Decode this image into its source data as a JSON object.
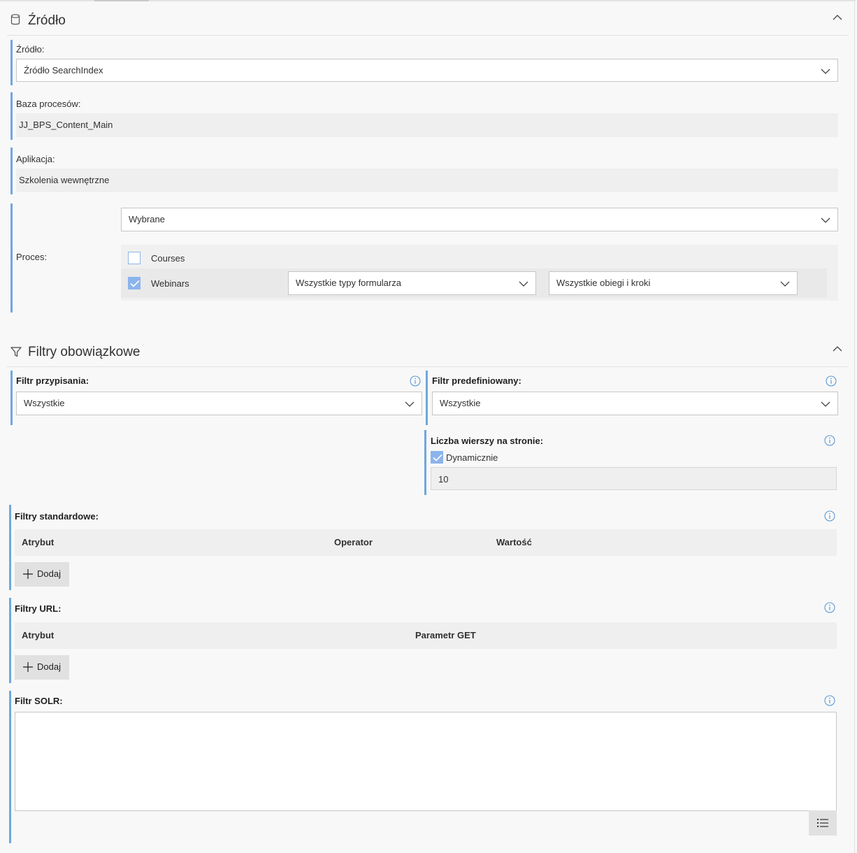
{
  "source_section": {
    "title": "Źródło",
    "source_label": "Źródło:",
    "source_value": "Źródło SearchIndex",
    "process_db_label": "Baza procesów:",
    "process_db_value": "JJ_BPS_Content_Main",
    "app_label": "Aplikacja:",
    "app_value": "Szkolenia wewnętrzne",
    "process_label": "Proces:",
    "process_mode": "Wybrane",
    "processes": [
      {
        "name": "Courses",
        "checked": false
      },
      {
        "name": "Webinars",
        "checked": true,
        "form_types": "Wszystkie typy formularza",
        "workflows": "Wszystkie obiegi i kroki"
      }
    ]
  },
  "filters_section": {
    "title": "Filtry obowiązkowe",
    "assignment_label": "Filtr przypisania:",
    "assignment_value": "Wszystkie",
    "predefined_label": "Filtr predefiniowany:",
    "predefined_value": "Wszystkie",
    "rows_label": "Liczba wierszy na stronie:",
    "dynamic_label": "Dynamicznie",
    "rows_value": "10",
    "standard_label": "Filtry standardowe:",
    "standard_columns": [
      "Atrybut",
      "Operator",
      "Wartość"
    ],
    "add_label": "Dodaj",
    "url_label": "Filtry URL:",
    "url_columns": [
      "Atrybut",
      "Parametr GET"
    ],
    "solr_label": "Filtr SOLR:"
  },
  "colors": {
    "accent_bar": "#6fa8dc",
    "checkbox_on": "#8cb4ec",
    "info_icon": "#5b9bd5"
  }
}
